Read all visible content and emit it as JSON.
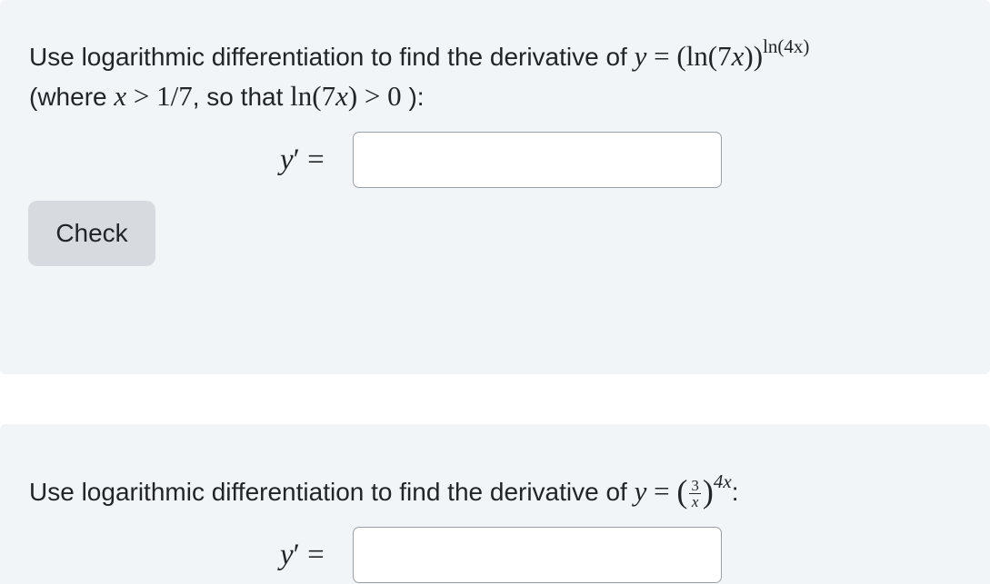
{
  "problem1": {
    "text_before": "Use logarithmic differentiation to find the derivative of ",
    "y_var": "y",
    "equals": " = ",
    "base_open": "(ln(7",
    "base_x": "x",
    "base_close": "))",
    "exponent": "ln(4x)",
    "line2_open": "(where ",
    "cond_x": "x",
    "cond_rel": " > 1/7",
    "line2_mid": ", so that ",
    "cond2_open": "ln(7",
    "cond2_x": "x",
    "cond2_close": ") > 0",
    "line2_end": " ):",
    "answer_label_y": "y",
    "answer_label_rest": "′ =",
    "answer_value": "",
    "check_label": "Check"
  },
  "problem2": {
    "text_before": "Use logarithmic differentiation to find the derivative of ",
    "y_var": "y",
    "equals": " = ",
    "frac_num": "3",
    "frac_den": "x",
    "exponent": "4x",
    "text_after": ":",
    "answer_label_y": "y",
    "answer_label_rest": "′ =",
    "answer_value": ""
  }
}
